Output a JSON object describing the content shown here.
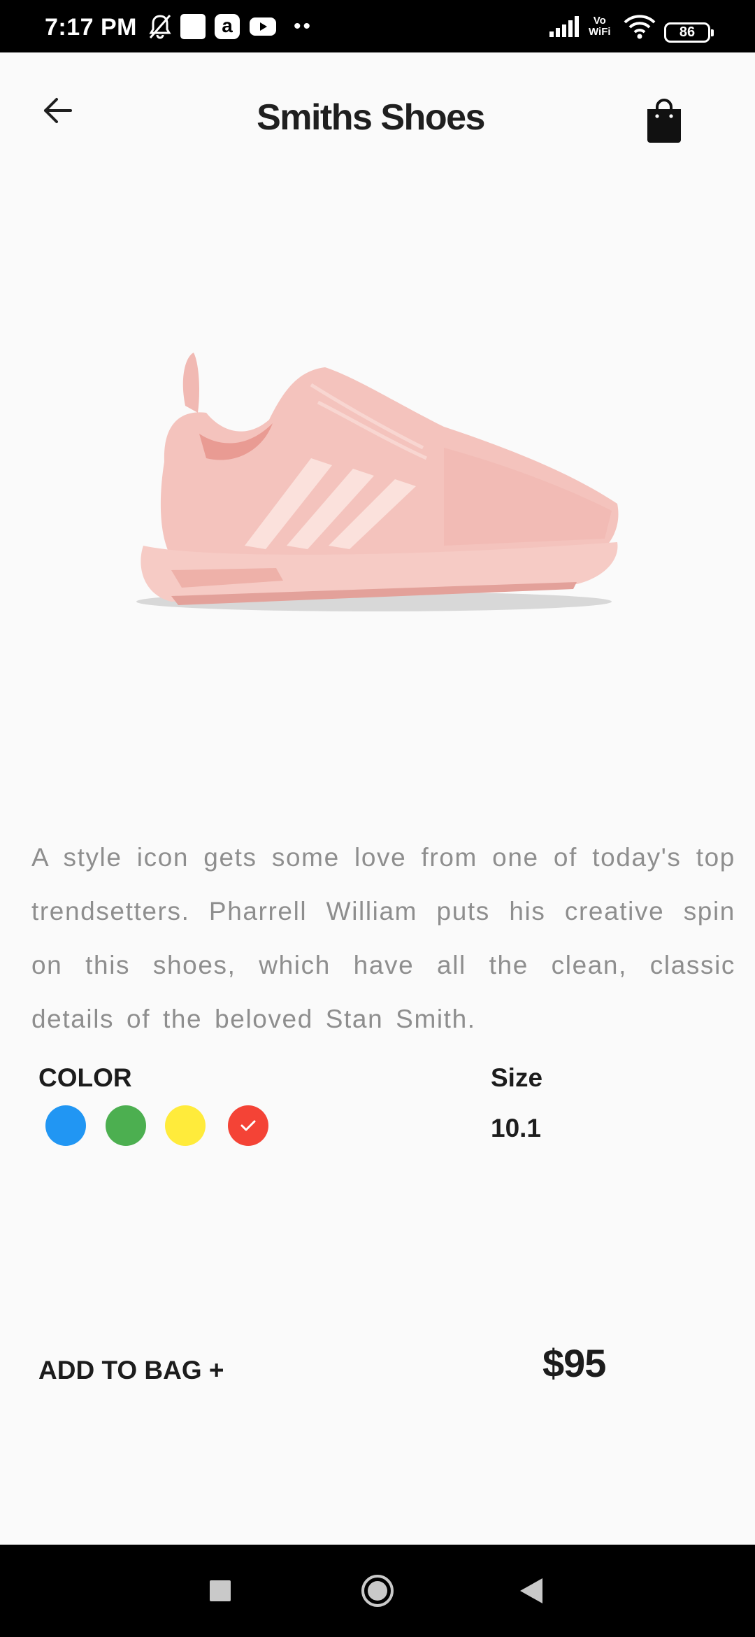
{
  "status_bar": {
    "time": "7:17 PM",
    "app_letter": "a",
    "dots": "••",
    "network_label_top": "Vo",
    "network_label_bottom": "WiFi",
    "battery": "86"
  },
  "header": {
    "title": "Smiths Shoes"
  },
  "product": {
    "description": "A style icon gets some love from one of today's top trendsetters. Pharrell William puts his creative spin on this shoes, which have all the clean, classic details of the beloved Stan Smith.",
    "color_label": "COLOR",
    "colors": [
      {
        "name": "blue",
        "hex": "#2196f3",
        "selected": false
      },
      {
        "name": "green",
        "hex": "#4caf50",
        "selected": false
      },
      {
        "name": "yellow",
        "hex": "#ffeb3b",
        "selected": false
      },
      {
        "name": "red",
        "hex": "#f44336",
        "selected": true
      }
    ],
    "size_label": "Size",
    "size_value": "10.1",
    "add_to_bag_label": "ADD TO BAG +",
    "price": "$95"
  },
  "icons": {
    "back": "arrow-left-icon",
    "bag": "shopping-bag-icon",
    "selected": "check-icon",
    "nav": [
      "recents-square-icon",
      "home-circle-icon",
      "back-triangle-icon"
    ]
  }
}
